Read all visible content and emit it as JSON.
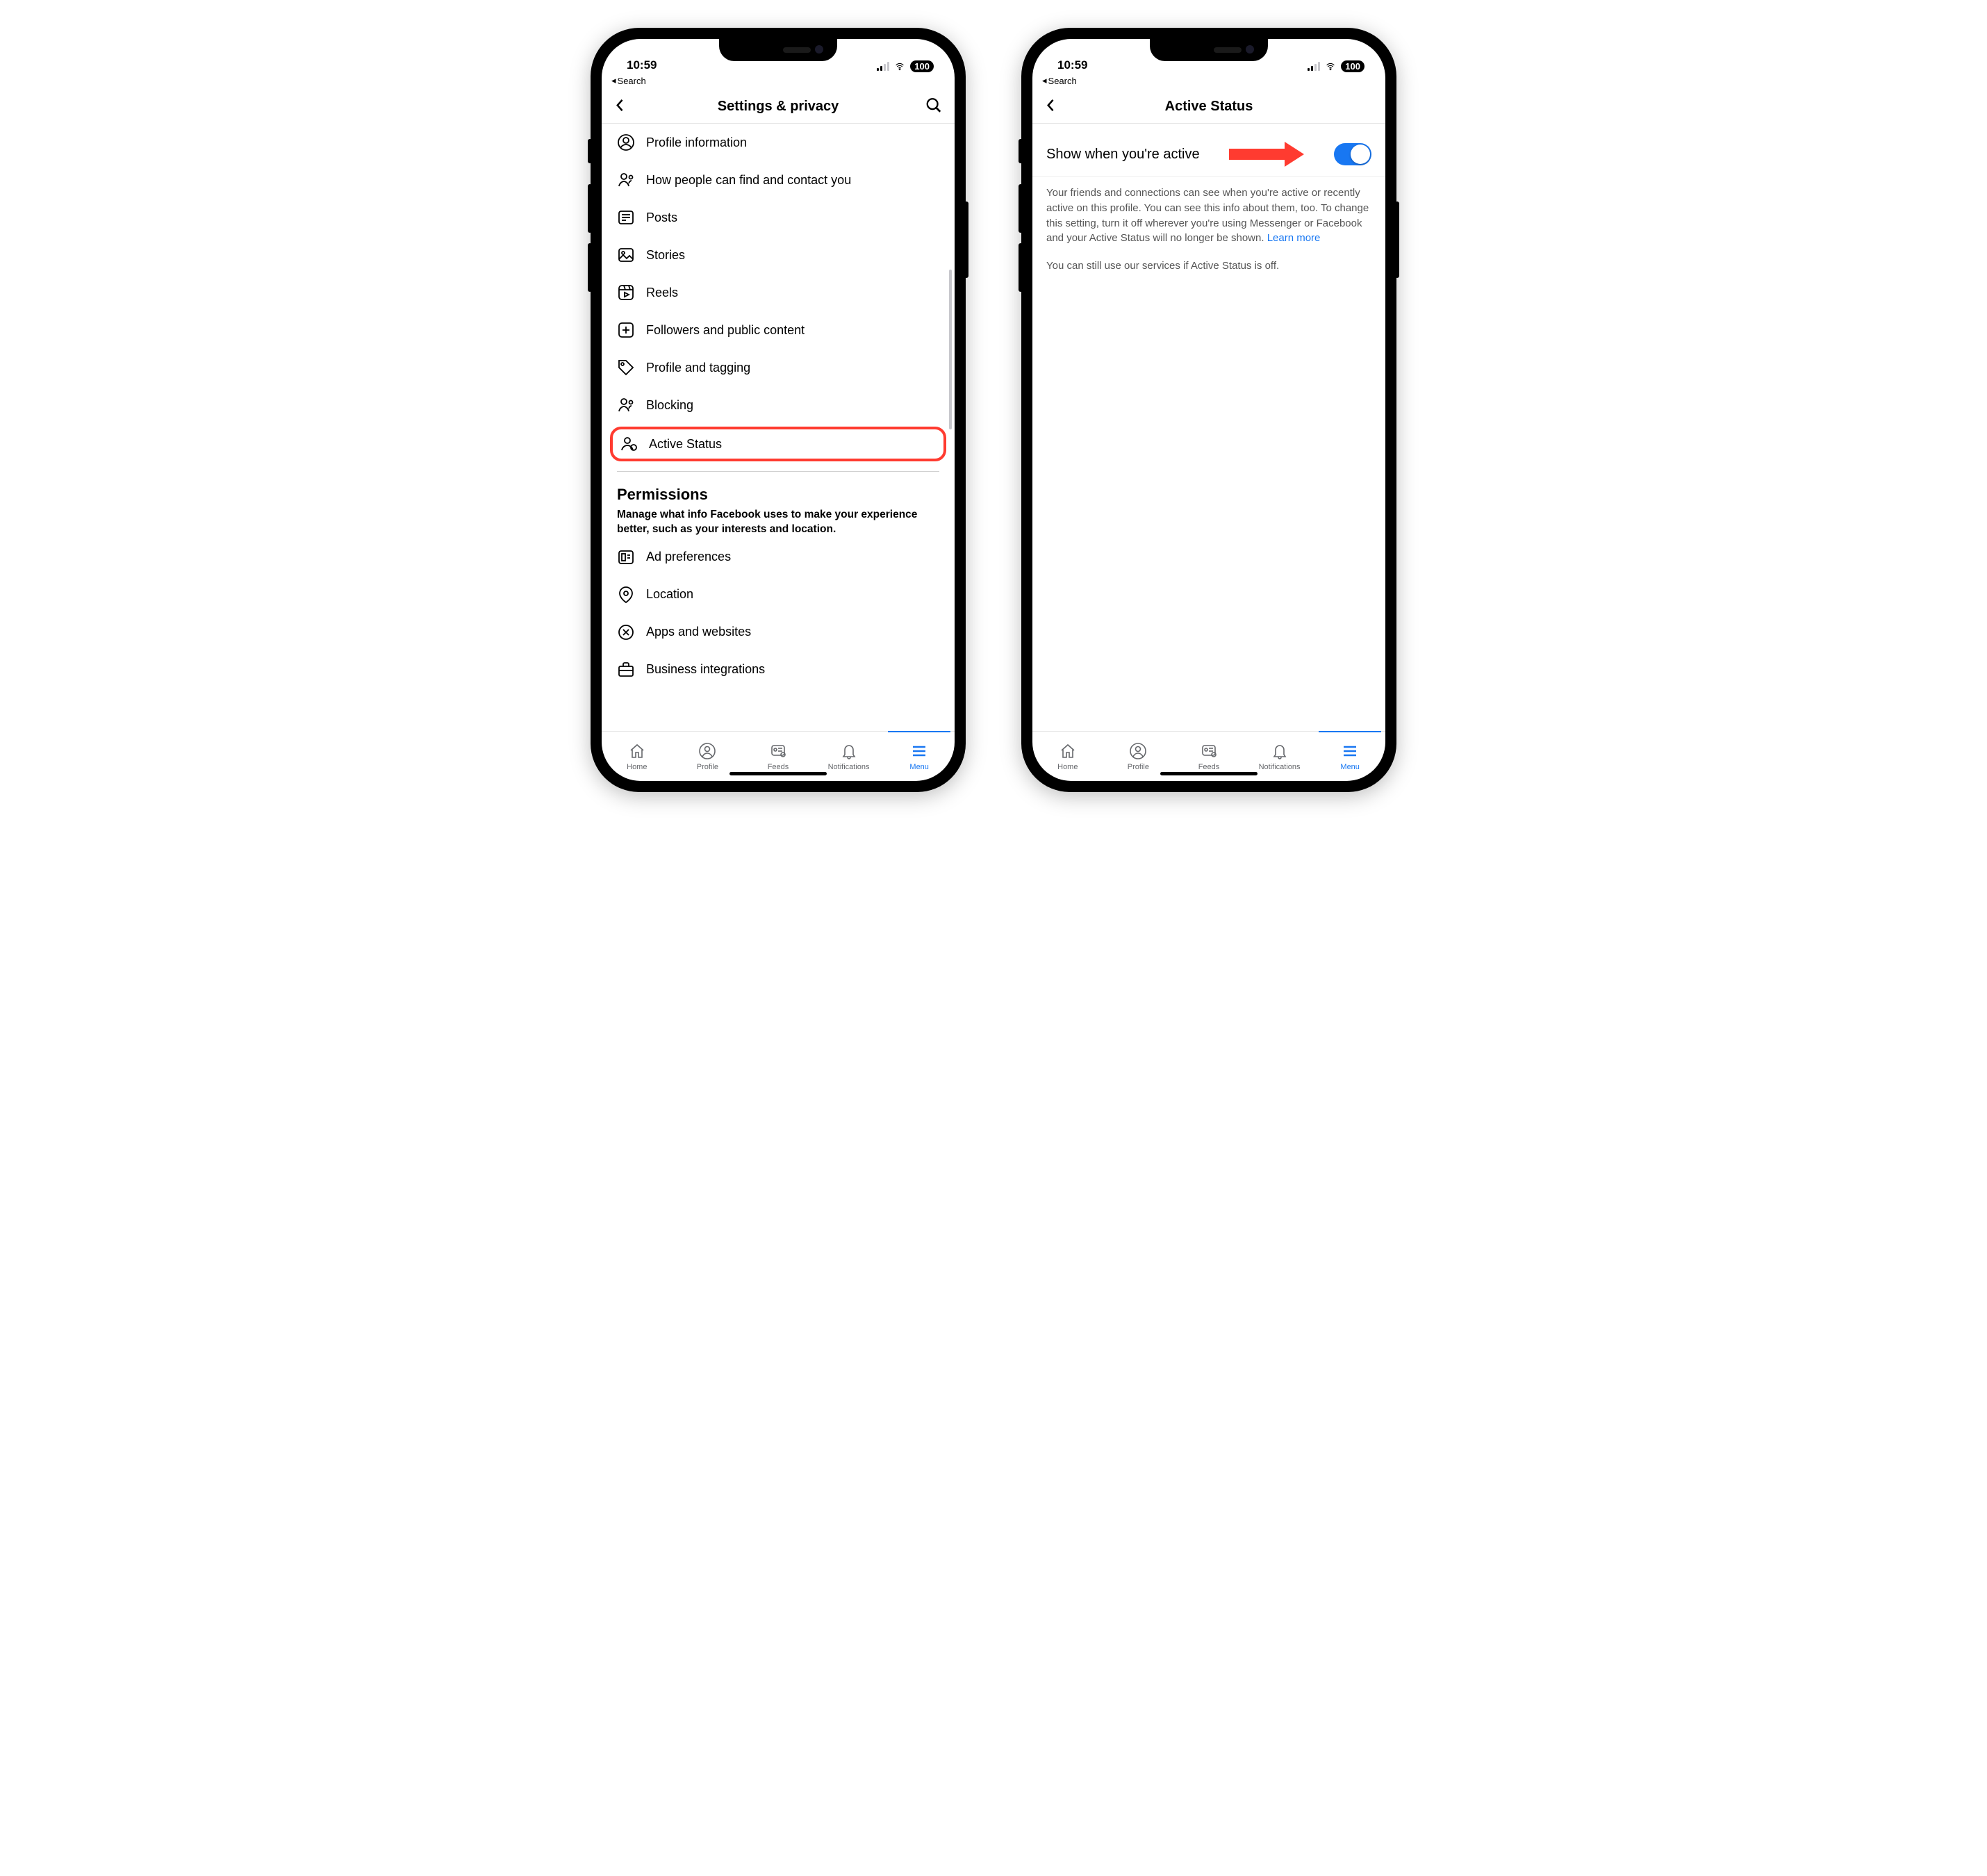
{
  "status": {
    "time": "10:59",
    "battery": "100",
    "breadcrumb": "Search"
  },
  "left": {
    "title": "Settings & privacy",
    "rows": [
      {
        "icon": "person-circle-icon",
        "label": "Profile information"
      },
      {
        "icon": "people-icon",
        "label": "How people can find and contact you"
      },
      {
        "icon": "newspaper-icon",
        "label": "Posts"
      },
      {
        "icon": "image-icon",
        "label": "Stories"
      },
      {
        "icon": "reels-icon",
        "label": "Reels"
      },
      {
        "icon": "plus-square-icon",
        "label": "Followers and public content"
      },
      {
        "icon": "tag-icon",
        "label": "Profile and tagging"
      },
      {
        "icon": "people-icon",
        "label": "Blocking"
      },
      {
        "icon": "person-status-icon",
        "label": "Active Status",
        "highlight": true
      }
    ],
    "section2": {
      "title": "Permissions",
      "subtitle": "Manage what info Facebook uses to make your experience better, such as your interests and location.",
      "rows": [
        {
          "icon": "ad-icon",
          "label": "Ad preferences"
        },
        {
          "icon": "location-pin-icon",
          "label": "Location"
        },
        {
          "icon": "apps-icon",
          "label": "Apps and websites"
        },
        {
          "icon": "briefcase-icon",
          "label": "Business integrations"
        }
      ]
    }
  },
  "right": {
    "title": "Active Status",
    "toggleLabel": "Show when you're active",
    "toggleOn": true,
    "descMain": "Your friends and connections can see when you're active or recently active on this profile. You can see this info about them, too. To change this setting, turn it off wherever you're using Messenger or Facebook and your Active Status will no longer be shown. ",
    "learnMore": "Learn more",
    "descSecondary": "You can still use our services if Active Status is off."
  },
  "tabs": [
    {
      "icon": "home-icon",
      "label": "Home"
    },
    {
      "icon": "profile-icon",
      "label": "Profile"
    },
    {
      "icon": "feeds-icon",
      "label": "Feeds"
    },
    {
      "icon": "bell-icon",
      "label": "Notifications"
    },
    {
      "icon": "menu-icon",
      "label": "Menu",
      "active": true
    }
  ]
}
